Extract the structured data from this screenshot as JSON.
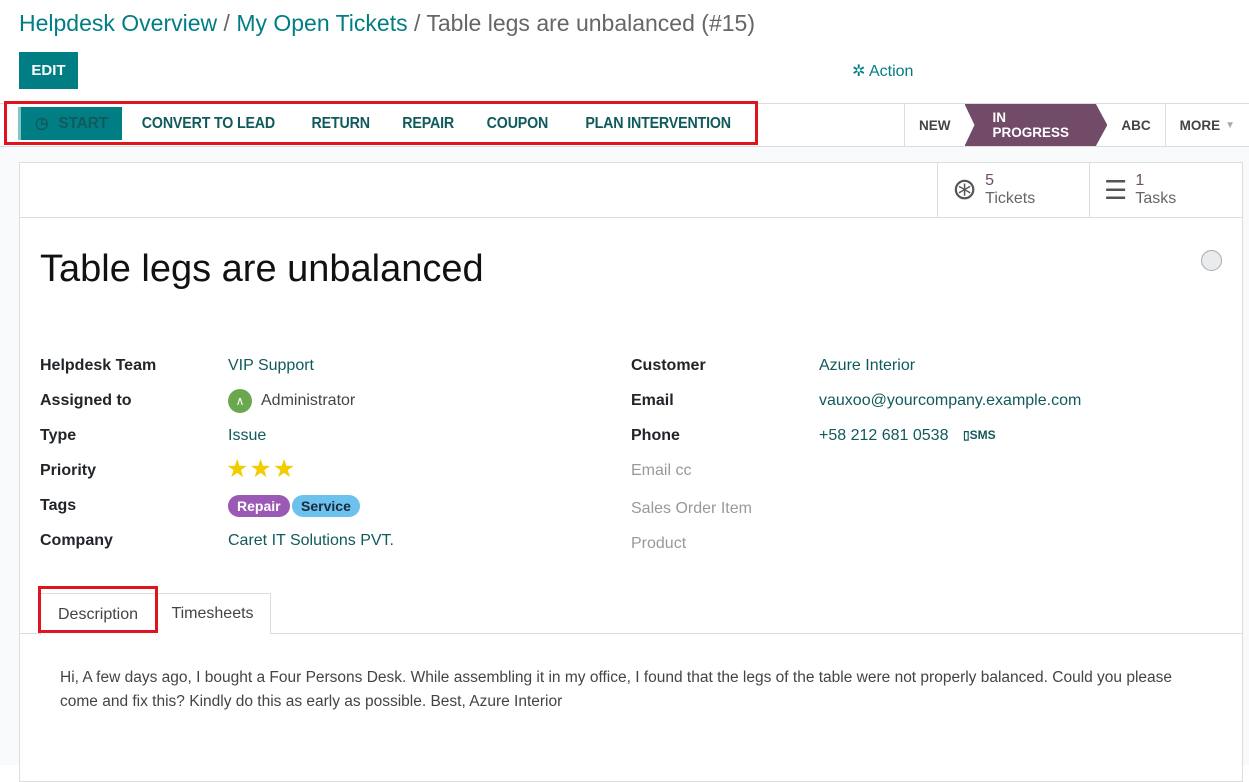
{
  "breadcrumb": {
    "items": [
      "Helpdesk Overview",
      "My Open Tickets"
    ],
    "current": "Table legs are unbalanced (#15)",
    "sep": "/"
  },
  "toolbar": {
    "edit_label": "EDIT",
    "action_label": "Action",
    "action_icon": "gear-icon"
  },
  "header_buttons": [
    {
      "label": "START",
      "icon": "clock-icon"
    },
    {
      "label": "CONVERT TO LEAD"
    },
    {
      "label": "RETURN"
    },
    {
      "label": "REPAIR"
    },
    {
      "label": "COUPON"
    },
    {
      "label": "PLAN INTERVENTION"
    }
  ],
  "stages": {
    "items": [
      "NEW",
      "IN PROGRESS",
      "ABC",
      "MORE"
    ],
    "active": "IN PROGRESS"
  },
  "stats": [
    {
      "count": "5",
      "label": "Tickets",
      "icon": "life-ring-icon"
    },
    {
      "count": "1",
      "label": "Tasks",
      "icon": "tasks-icon"
    }
  ],
  "ticket": {
    "title": "Table legs are unbalanced"
  },
  "left_fields": {
    "team_label": "Helpdesk Team",
    "team": "VIP Support",
    "assigned_label": "Assigned to",
    "assigned": "Administrator",
    "type_label": "Type",
    "type": "Issue",
    "priority_label": "Priority",
    "priority_stars": 3,
    "tags_label": "Tags",
    "tags": [
      "Repair",
      "Service"
    ],
    "company_label": "Company",
    "company": "Caret IT Solutions PVT."
  },
  "right_fields": {
    "customer_label": "Customer",
    "customer": "Azure Interior",
    "email_label": "Email",
    "email": "vauxoo@yourcompany.example.com",
    "phone_label": "Phone",
    "phone": "+58 212 681 0538",
    "sms_label": "SMS",
    "emailcc_label": "Email cc",
    "sale_item_label": "Sales Order Item",
    "product_label": "Product"
  },
  "tabs": [
    "Description",
    "Timesheets"
  ],
  "description": "Hi, A few days ago, I bought a Four Persons Desk. While assembling it in my office, I found that the legs of the table were not properly balanced. Could you please come and fix this? Kindly do this as early as possible. Best, Azure Interior",
  "colors": {
    "primary": "#017e84",
    "stage_active": "#714b67",
    "star": "#f3cc00",
    "tag_repair": "#9b59b6",
    "tag_service": "#6cc1ed",
    "highlight": "#e0141e"
  }
}
